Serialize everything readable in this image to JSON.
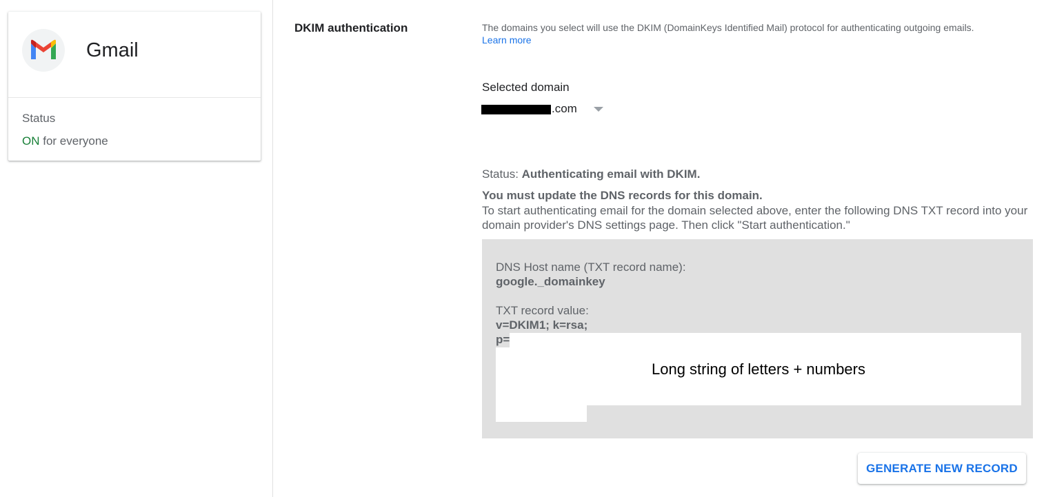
{
  "app": {
    "title": "Gmail",
    "icon": "gmail-logo-icon"
  },
  "status_card": {
    "label": "Status",
    "on_text": "ON",
    "rest_text": "for everyone"
  },
  "dkim": {
    "title": "DKIM authentication",
    "description": "The domains you select will use the DKIM (DomainKeys Identified Mail) protocol for authenticating outgoing emails.",
    "learn_more": "Learn more",
    "selected_domain_label": "Selected domain",
    "domain_suffix": ".com",
    "status_prefix": "Status:",
    "status_value": "Authenticating email with DKIM.",
    "dns_warning": "You must update the DNS records for this domain.",
    "dns_instructions": "To start authenticating email for the domain selected above, enter the following DNS TXT record into your domain provider's DNS settings page. Then click \"Start authentication.\"",
    "host_label": "DNS Host name (TXT record name):",
    "host_value": "google._domainkey",
    "txt_label": "TXT record value:",
    "txt_value_line1": "v=DKIM1; k=rsa;",
    "txt_value_line2": "p=",
    "redaction_note": "Long string of letters + numbers",
    "generate_button": "GENERATE NEW RECORD"
  },
  "colors": {
    "accent": "#1a73e8",
    "on_green": "#188038",
    "record_bg": "#e0e0e0"
  }
}
